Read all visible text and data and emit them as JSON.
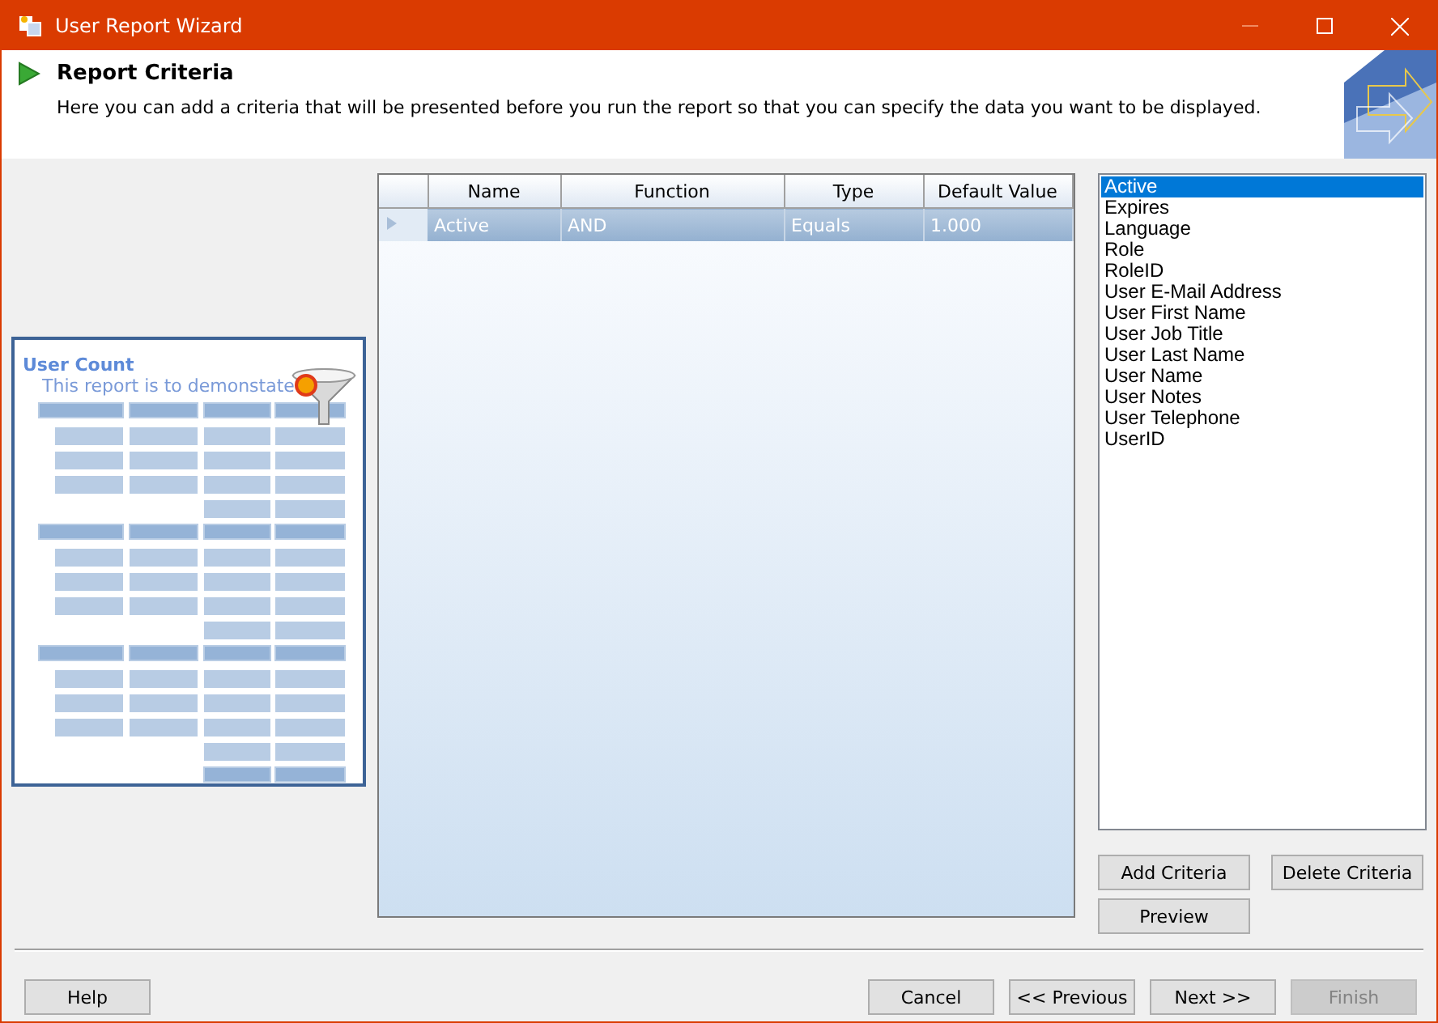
{
  "window": {
    "title": "User Report Wizard"
  },
  "header": {
    "title": "Report Criteria",
    "description": "Here you can add a criteria that will be presented before you run the report so that you can specify the data you want to be displayed."
  },
  "preview": {
    "title": "User Count",
    "subtitle": "This report is to demonstate"
  },
  "grid": {
    "columns": [
      "Name",
      "Function",
      "Type",
      "Default Value"
    ],
    "rows": [
      {
        "cells": [
          "Active",
          "AND",
          "Equals",
          "1.000"
        ],
        "selected": true
      }
    ]
  },
  "fields": [
    {
      "label": "Active",
      "selected": true
    },
    {
      "label": "Expires",
      "selected": false
    },
    {
      "label": "Language",
      "selected": false
    },
    {
      "label": "Role",
      "selected": false
    },
    {
      "label": "RoleID",
      "selected": false
    },
    {
      "label": "User E-Mail Address",
      "selected": false
    },
    {
      "label": "User First Name",
      "selected": false
    },
    {
      "label": "User Job Title",
      "selected": false
    },
    {
      "label": "User Last Name",
      "selected": false
    },
    {
      "label": "User Name",
      "selected": false
    },
    {
      "label": "User Notes",
      "selected": false
    },
    {
      "label": "User Telephone",
      "selected": false
    },
    {
      "label": "UserID",
      "selected": false
    }
  ],
  "criteria_buttons": [
    {
      "label": "Add Criteria",
      "disabled": false
    },
    {
      "label": "Delete Criteria",
      "disabled": false
    },
    {
      "label": "Preview",
      "disabled": false
    }
  ],
  "help_button": {
    "label": "Help",
    "disabled": false
  },
  "nav_buttons": [
    {
      "label": "Cancel",
      "disabled": false
    },
    {
      "label": "<< Previous",
      "disabled": false
    },
    {
      "label": "Next >>",
      "disabled": false
    },
    {
      "label": "Finish",
      "disabled": true
    }
  ]
}
